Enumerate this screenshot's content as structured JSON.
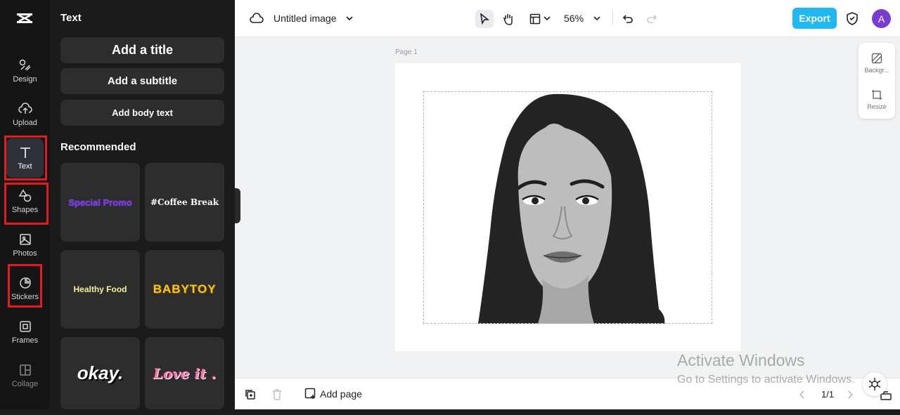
{
  "rail": {
    "items": [
      {
        "label": "Design"
      },
      {
        "label": "Upload"
      },
      {
        "label": "Text"
      },
      {
        "label": "Shapes"
      },
      {
        "label": "Photos"
      },
      {
        "label": "Stickers"
      },
      {
        "label": "Frames"
      },
      {
        "label": "Collage"
      }
    ]
  },
  "panel": {
    "title": "Text",
    "add_title": "Add a title",
    "add_subtitle": "Add a subtitle",
    "add_body": "Add body text",
    "recommended": "Recommended",
    "presets": [
      {
        "text": "Special Promo",
        "color": "#7b2ff7"
      },
      {
        "text": "#Coffee Break",
        "color": "#ffffff"
      },
      {
        "text": "Healthy Food",
        "color": "#f4f0a0"
      },
      {
        "text": "BABYTOY",
        "color": "#f5c518"
      },
      {
        "text": "okay.",
        "color": "#ffffff"
      },
      {
        "text": "Love it .",
        "color": "#ff6fa8"
      }
    ]
  },
  "topbar": {
    "doc_title": "Untitled image",
    "zoom": "56%",
    "export": "Export",
    "avatar_initial": "A"
  },
  "canvas": {
    "page_label": "Page 1"
  },
  "right_tools": {
    "background": "Backgr...",
    "resize": "Resize"
  },
  "bottombar": {
    "add_page": "Add page",
    "pager": "1/1"
  },
  "watermark": {
    "title": "Activate Windows",
    "subtitle": "Go to Settings to activate Windows."
  },
  "colors": {
    "accent": "#1fb8f0",
    "highlight": "#e21b1b",
    "avatar": "#7a3bd1"
  }
}
